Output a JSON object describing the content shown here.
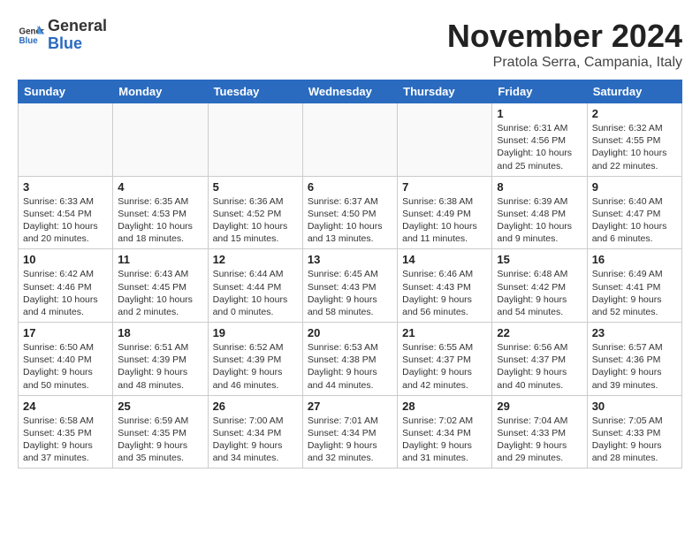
{
  "header": {
    "logo_general": "General",
    "logo_blue": "Blue",
    "month_title": "November 2024",
    "location": "Pratola Serra, Campania, Italy"
  },
  "weekdays": [
    "Sunday",
    "Monday",
    "Tuesday",
    "Wednesday",
    "Thursday",
    "Friday",
    "Saturday"
  ],
  "weeks": [
    [
      {
        "day": "",
        "info": ""
      },
      {
        "day": "",
        "info": ""
      },
      {
        "day": "",
        "info": ""
      },
      {
        "day": "",
        "info": ""
      },
      {
        "day": "",
        "info": ""
      },
      {
        "day": "1",
        "info": "Sunrise: 6:31 AM\nSunset: 4:56 PM\nDaylight: 10 hours and 25 minutes."
      },
      {
        "day": "2",
        "info": "Sunrise: 6:32 AM\nSunset: 4:55 PM\nDaylight: 10 hours and 22 minutes."
      }
    ],
    [
      {
        "day": "3",
        "info": "Sunrise: 6:33 AM\nSunset: 4:54 PM\nDaylight: 10 hours and 20 minutes."
      },
      {
        "day": "4",
        "info": "Sunrise: 6:35 AM\nSunset: 4:53 PM\nDaylight: 10 hours and 18 minutes."
      },
      {
        "day": "5",
        "info": "Sunrise: 6:36 AM\nSunset: 4:52 PM\nDaylight: 10 hours and 15 minutes."
      },
      {
        "day": "6",
        "info": "Sunrise: 6:37 AM\nSunset: 4:50 PM\nDaylight: 10 hours and 13 minutes."
      },
      {
        "day": "7",
        "info": "Sunrise: 6:38 AM\nSunset: 4:49 PM\nDaylight: 10 hours and 11 minutes."
      },
      {
        "day": "8",
        "info": "Sunrise: 6:39 AM\nSunset: 4:48 PM\nDaylight: 10 hours and 9 minutes."
      },
      {
        "day": "9",
        "info": "Sunrise: 6:40 AM\nSunset: 4:47 PM\nDaylight: 10 hours and 6 minutes."
      }
    ],
    [
      {
        "day": "10",
        "info": "Sunrise: 6:42 AM\nSunset: 4:46 PM\nDaylight: 10 hours and 4 minutes."
      },
      {
        "day": "11",
        "info": "Sunrise: 6:43 AM\nSunset: 4:45 PM\nDaylight: 10 hours and 2 minutes."
      },
      {
        "day": "12",
        "info": "Sunrise: 6:44 AM\nSunset: 4:44 PM\nDaylight: 10 hours and 0 minutes."
      },
      {
        "day": "13",
        "info": "Sunrise: 6:45 AM\nSunset: 4:43 PM\nDaylight: 9 hours and 58 minutes."
      },
      {
        "day": "14",
        "info": "Sunrise: 6:46 AM\nSunset: 4:43 PM\nDaylight: 9 hours and 56 minutes."
      },
      {
        "day": "15",
        "info": "Sunrise: 6:48 AM\nSunset: 4:42 PM\nDaylight: 9 hours and 54 minutes."
      },
      {
        "day": "16",
        "info": "Sunrise: 6:49 AM\nSunset: 4:41 PM\nDaylight: 9 hours and 52 minutes."
      }
    ],
    [
      {
        "day": "17",
        "info": "Sunrise: 6:50 AM\nSunset: 4:40 PM\nDaylight: 9 hours and 50 minutes."
      },
      {
        "day": "18",
        "info": "Sunrise: 6:51 AM\nSunset: 4:39 PM\nDaylight: 9 hours and 48 minutes."
      },
      {
        "day": "19",
        "info": "Sunrise: 6:52 AM\nSunset: 4:39 PM\nDaylight: 9 hours and 46 minutes."
      },
      {
        "day": "20",
        "info": "Sunrise: 6:53 AM\nSunset: 4:38 PM\nDaylight: 9 hours and 44 minutes."
      },
      {
        "day": "21",
        "info": "Sunrise: 6:55 AM\nSunset: 4:37 PM\nDaylight: 9 hours and 42 minutes."
      },
      {
        "day": "22",
        "info": "Sunrise: 6:56 AM\nSunset: 4:37 PM\nDaylight: 9 hours and 40 minutes."
      },
      {
        "day": "23",
        "info": "Sunrise: 6:57 AM\nSunset: 4:36 PM\nDaylight: 9 hours and 39 minutes."
      }
    ],
    [
      {
        "day": "24",
        "info": "Sunrise: 6:58 AM\nSunset: 4:35 PM\nDaylight: 9 hours and 37 minutes."
      },
      {
        "day": "25",
        "info": "Sunrise: 6:59 AM\nSunset: 4:35 PM\nDaylight: 9 hours and 35 minutes."
      },
      {
        "day": "26",
        "info": "Sunrise: 7:00 AM\nSunset: 4:34 PM\nDaylight: 9 hours and 34 minutes."
      },
      {
        "day": "27",
        "info": "Sunrise: 7:01 AM\nSunset: 4:34 PM\nDaylight: 9 hours and 32 minutes."
      },
      {
        "day": "28",
        "info": "Sunrise: 7:02 AM\nSunset: 4:34 PM\nDaylight: 9 hours and 31 minutes."
      },
      {
        "day": "29",
        "info": "Sunrise: 7:04 AM\nSunset: 4:33 PM\nDaylight: 9 hours and 29 minutes."
      },
      {
        "day": "30",
        "info": "Sunrise: 7:05 AM\nSunset: 4:33 PM\nDaylight: 9 hours and 28 minutes."
      }
    ]
  ]
}
